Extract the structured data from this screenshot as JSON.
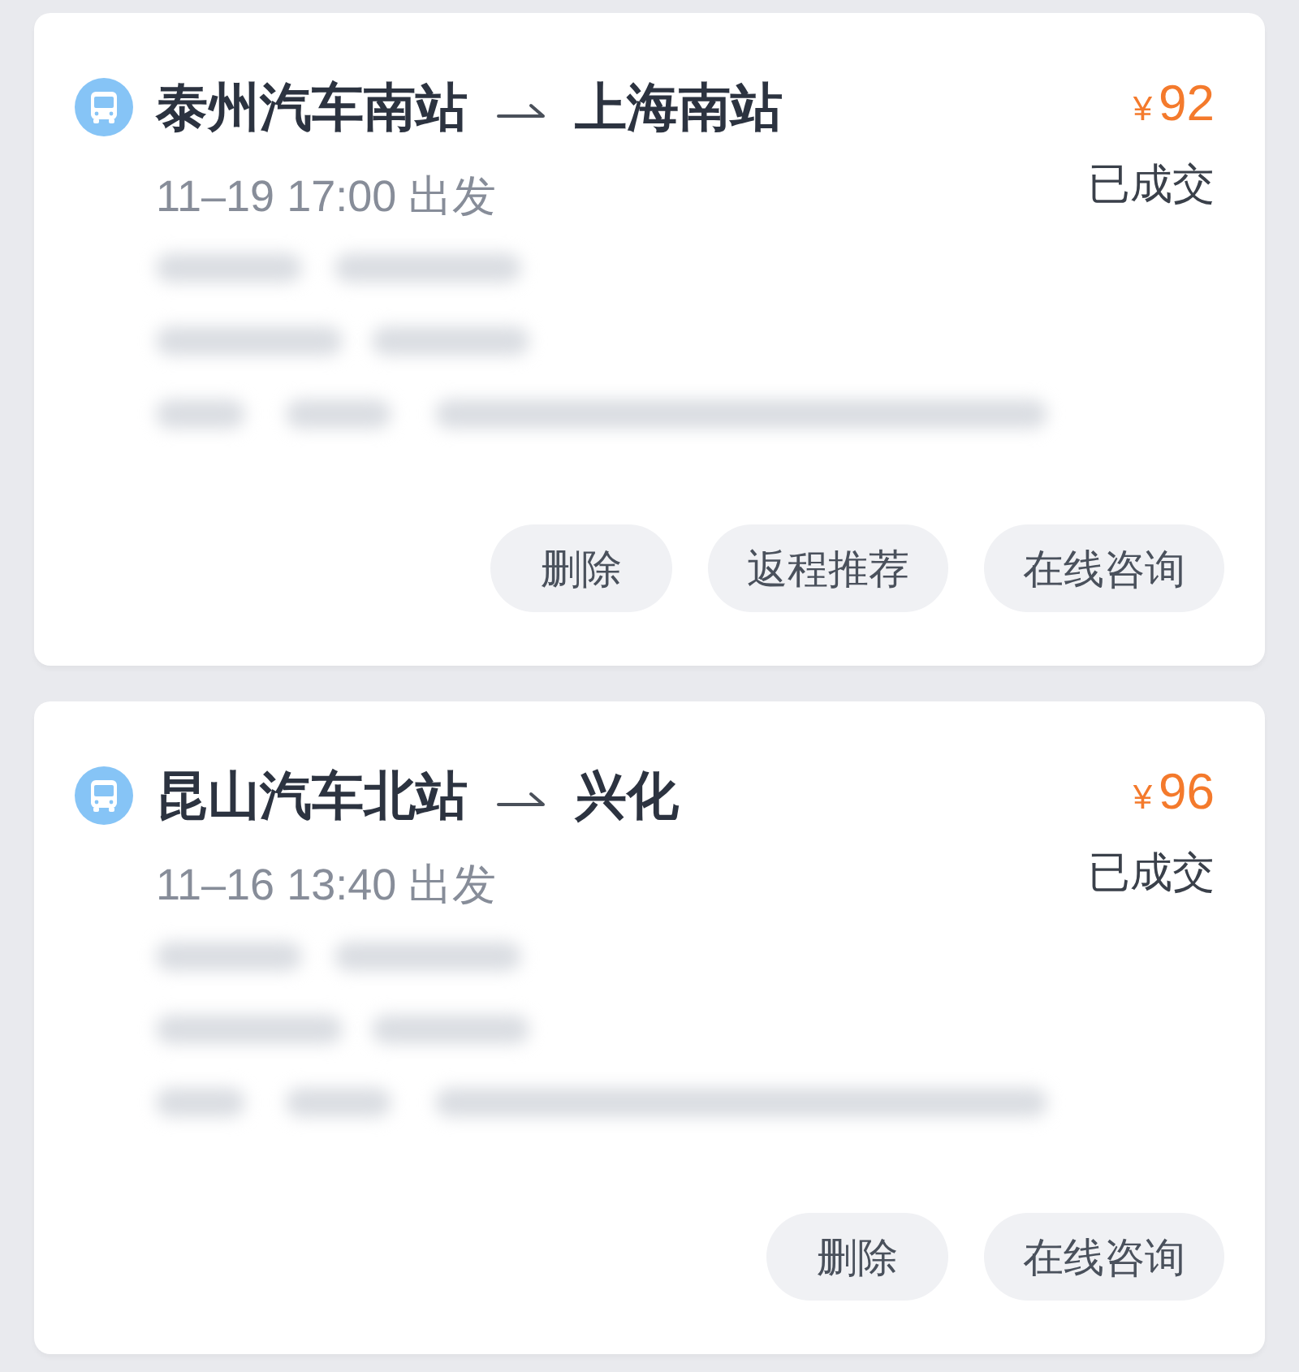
{
  "orders": [
    {
      "origin": "泰州汽车南站",
      "destination": "上海南站",
      "departure": "11–19 17:00 出发",
      "currency": "¥",
      "price": "92",
      "status": "已成交",
      "actions": [
        "删除",
        "返程推荐",
        "在线咨询"
      ]
    },
    {
      "origin": "昆山汽车北站",
      "destination": "兴化",
      "departure": "11–16 13:40 出发",
      "currency": "¥",
      "price": "96",
      "status": "已成交",
      "actions": [
        "删除",
        "在线咨询"
      ]
    }
  ]
}
